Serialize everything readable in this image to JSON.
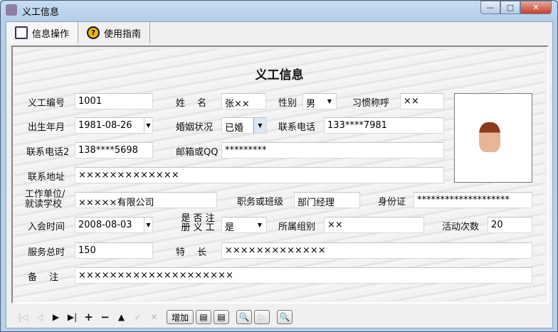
{
  "window": {
    "title": "义工信息",
    "minimize": "—",
    "maximize": "□",
    "close": "✕"
  },
  "tabs": [
    {
      "label": "信息操作",
      "icon": "info-op-icon"
    },
    {
      "label": "使用指南",
      "icon": "help-icon"
    }
  ],
  "form": {
    "title": "义工信息",
    "fields": {
      "id": {
        "label": "义工编号",
        "value": "1001"
      },
      "name": {
        "label": "姓　 名",
        "value": "张××"
      },
      "gender": {
        "label": "性别",
        "value": "男"
      },
      "nickname": {
        "label": "习惯称呼",
        "value": "××"
      },
      "birth": {
        "label": "出生年月",
        "value": "1981-08-26"
      },
      "marital": {
        "label": "婚姻状况",
        "value": "已婚"
      },
      "phone": {
        "label": "联系电话",
        "value": "133****7981"
      },
      "phone2": {
        "label": "联系电话2",
        "value": "138****5698"
      },
      "email": {
        "label": "邮箱或QQ",
        "value": "*********"
      },
      "address": {
        "label": "联系地址",
        "value": "×××××××××××××"
      },
      "work_l1": "工作单位/",
      "work_l2": "就读学校",
      "work": {
        "value": "×××××有限公司"
      },
      "position": {
        "label": "职务或班级",
        "value": "部门经理"
      },
      "idcard": {
        "label": "身份证",
        "value": "********************"
      },
      "join": {
        "label": "入会时间",
        "value": "2008-08-03"
      },
      "registered": {
        "label_top": "是 否 注",
        "label_bottom": "册 义 工",
        "value": "是"
      },
      "group": {
        "label": "所属组别",
        "value": "××"
      },
      "activities": {
        "label": "活动次数",
        "value": "20"
      },
      "hours": {
        "label": "服务总时",
        "value": "150"
      },
      "specialty": {
        "label": "特　 长",
        "value": "×××××××××××××"
      },
      "remark": {
        "label": "备　 注",
        "value": "××××××××××××××××××××"
      }
    }
  },
  "toolbar": {
    "add_label": "增加"
  }
}
